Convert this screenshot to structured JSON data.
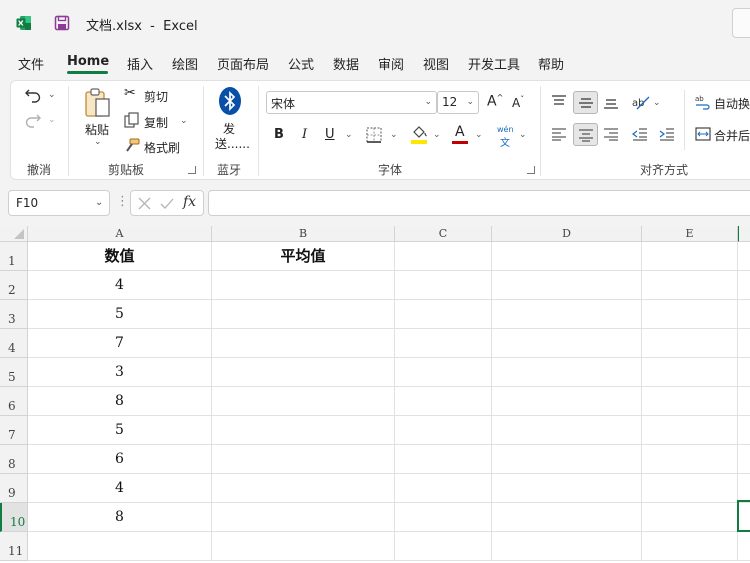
{
  "title": {
    "file_name": "文档.xlsx",
    "separator": "-",
    "app_name": "Excel"
  },
  "menu": [
    "文件",
    "Home",
    "插入",
    "绘图",
    "页面布局",
    "公式",
    "数据",
    "审阅",
    "视图",
    "开发工具",
    "帮助"
  ],
  "active_tab": "Home",
  "ribbon": {
    "undo_group": "撤消",
    "clipboard": {
      "paste": "粘贴",
      "cut": "剪切",
      "copy": "复制",
      "format_painter": "格式刷",
      "group": "剪贴板"
    },
    "bluetooth": {
      "send_line1": "发",
      "send_line2": "送......",
      "group": "蓝牙"
    },
    "font": {
      "name": "宋体",
      "size": "12",
      "bold": "B",
      "italic": "I",
      "underline": "U",
      "phonetic_top": "wén",
      "phonetic_bottom": "文",
      "font_color_letter": "A",
      "group": "字体"
    },
    "alignment": {
      "wrap": "自动换",
      "merge": "合并后",
      "group": "对齐方式"
    }
  },
  "formula_bar": {
    "name_box": "F10",
    "fx": "fx",
    "formula": ""
  },
  "sheet": {
    "columns": [
      "A",
      "B",
      "C",
      "D",
      "E"
    ],
    "rows": [
      "1",
      "2",
      "3",
      "4",
      "5",
      "6",
      "7",
      "8",
      "9",
      "10",
      "11"
    ],
    "header_a": "数值",
    "header_b": "平均值",
    "values": [
      "4",
      "5",
      "7",
      "3",
      "8",
      "5",
      "6",
      "4",
      "8"
    ]
  },
  "colors": {
    "accent": "#107c41",
    "font_color_bar": "#c00000",
    "highlight_bar": "#ffe600"
  }
}
